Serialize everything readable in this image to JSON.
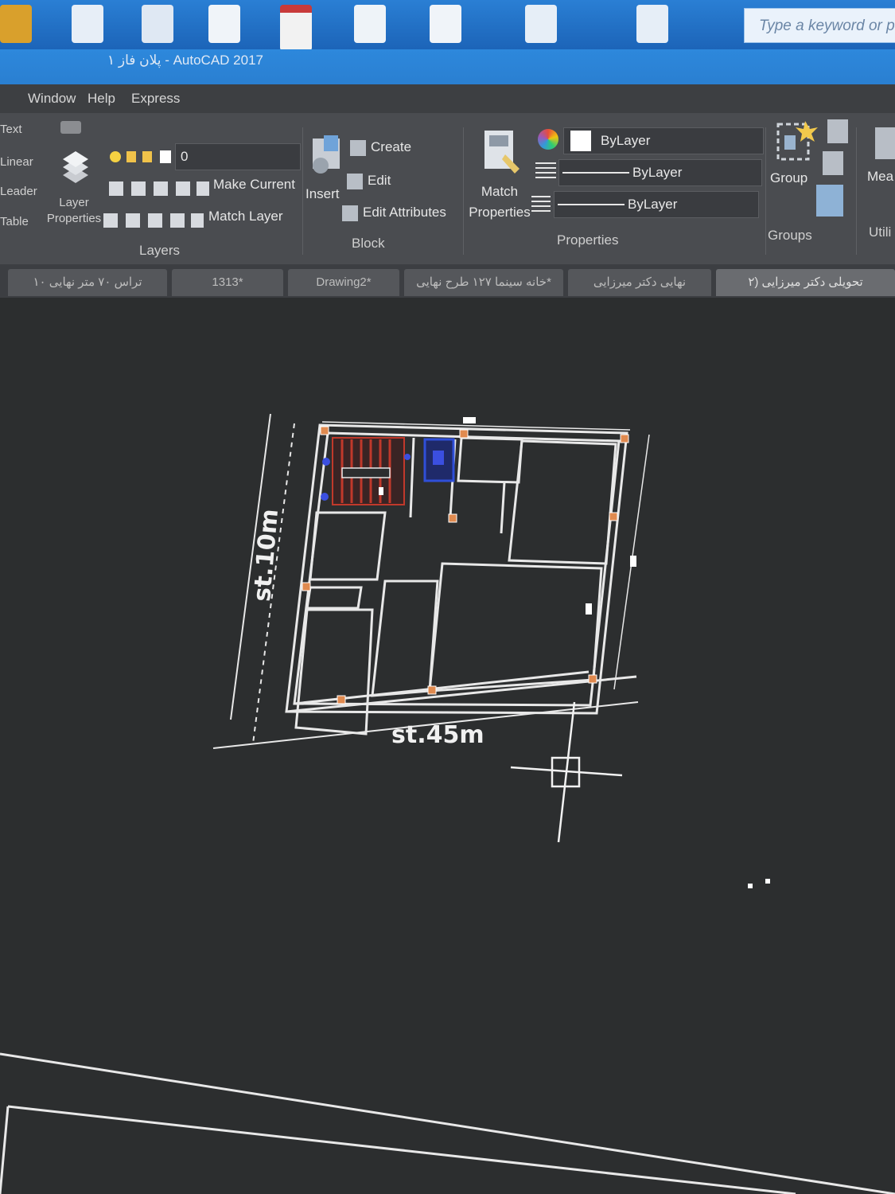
{
  "titlebar": {
    "search_placeholder": "Type a keyword or phr",
    "window_title": "پلان فاز ۱ - AutoCAD 2017"
  },
  "menu": [
    "Window",
    "Help",
    "Express"
  ],
  "ribbon": {
    "left_labels": [
      "Text",
      "Linear",
      "Leader",
      "Table"
    ],
    "layers": {
      "layer_properties_label": "Layer\nProperties",
      "current_layer": "0",
      "make_current": "Make Current",
      "match_layer": "Match Layer",
      "panel_title": "Layers"
    },
    "block": {
      "insert": "Insert",
      "create": "Create",
      "edit": "Edit",
      "edit_attributes": "Edit Attributes",
      "panel_title": "Block"
    },
    "properties": {
      "match_properties": "Match\nProperties",
      "color": "ByLayer",
      "linetype": "ByLayer",
      "lineweight": "ByLayer",
      "panel_title": "Properties"
    },
    "groups": {
      "group": "Group",
      "panel_title": "Groups"
    },
    "utilities": {
      "measure": "Mea",
      "panel_title": "Utili"
    }
  },
  "file_tabs": [
    "تراس ۷۰ متر نهایی ۱۰",
    "1313*",
    "Drawing2*",
    "خانه سینما ۱۲۷ طرح نهایی*",
    "نهایی دکتر میرزایی",
    "۲) تحویلی دکتر میرزایی"
  ],
  "drawing": {
    "label_left": "st.10m",
    "label_bottom": "st.45m",
    "colors": {
      "walls": "#e8e8e8",
      "stairs": "#c0392b",
      "elevator": "#2f4fd8",
      "grips": "#e08a4f"
    }
  }
}
